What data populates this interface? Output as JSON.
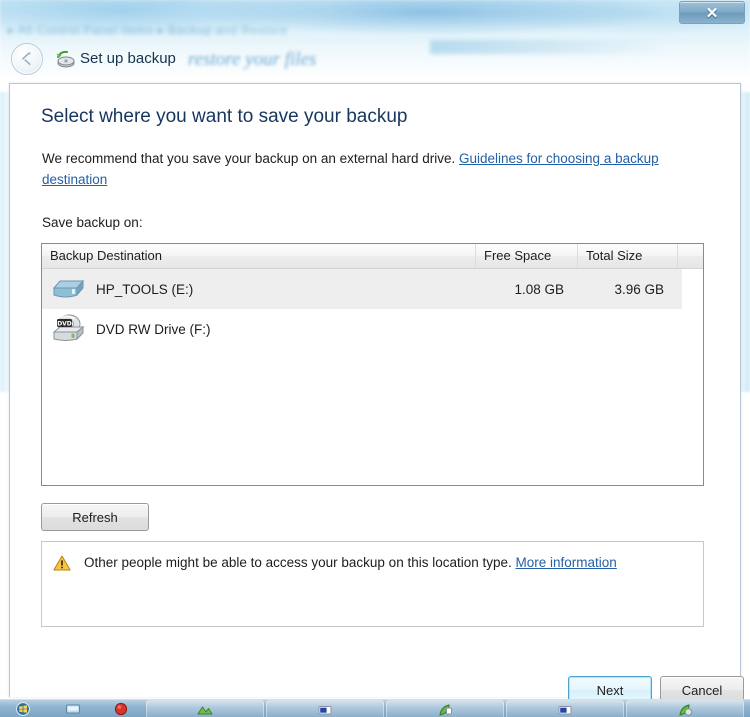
{
  "window": {
    "close_label": "✕",
    "background_breadcrumb": "▸ All Control Panel Items ▸ Backup and Restore",
    "background_heading": "restore your files"
  },
  "wizard": {
    "back_label": "Back",
    "title": "Set up backup",
    "icon": "backup-wizard-icon"
  },
  "page": {
    "heading": "Select where you want to save your backup",
    "intro_before_link": "We recommend that you save your backup on an external hard drive. ",
    "intro_link": "Guidelines for choosing a backup destination",
    "save_on_label": "Save backup on:"
  },
  "listview": {
    "columns": [
      {
        "key": "name",
        "label": "Backup Destination"
      },
      {
        "key": "free",
        "label": "Free Space"
      },
      {
        "key": "total",
        "label": "Total Size"
      },
      {
        "key": "pad",
        "label": ""
      }
    ],
    "rows": [
      {
        "icon": "hard-drive-icon",
        "name": "HP_TOOLS (E:)",
        "free": "1.08 GB",
        "total": "3.96 GB",
        "selected": true
      },
      {
        "icon": "dvd-drive-icon",
        "name": "DVD RW Drive (F:)",
        "free": "",
        "total": "",
        "selected": false
      }
    ]
  },
  "buttons": {
    "refresh": "Refresh",
    "next": "Next",
    "cancel": "Cancel"
  },
  "warning": {
    "icon": "warning-triangle-icon",
    "text_before_link": "Other people might be able to access your backup on this location type. ",
    "link": "More information"
  },
  "taskbar": {
    "items": [
      {
        "name": "start-orb",
        "glyph": "start-orb-icon"
      },
      {
        "name": "quick-launch-1",
        "glyph": "show-desktop-icon"
      },
      {
        "name": "quick-launch-2",
        "glyph": "media-icon"
      },
      {
        "name": "taskbar-window-1",
        "glyph": "mountains-icon"
      },
      {
        "name": "taskbar-window-2",
        "glyph": "folder-blue-icon"
      },
      {
        "name": "taskbar-window-3",
        "glyph": "leaf-icon"
      },
      {
        "name": "taskbar-window-4",
        "glyph": "folder-blue-icon"
      },
      {
        "name": "taskbar-window-5",
        "glyph": "leaf-icon"
      }
    ]
  },
  "colors": {
    "heading": "#17365d",
    "link": "#2460a8",
    "selection": "#eeeeee",
    "accent_focus": "#4fa3d1"
  }
}
